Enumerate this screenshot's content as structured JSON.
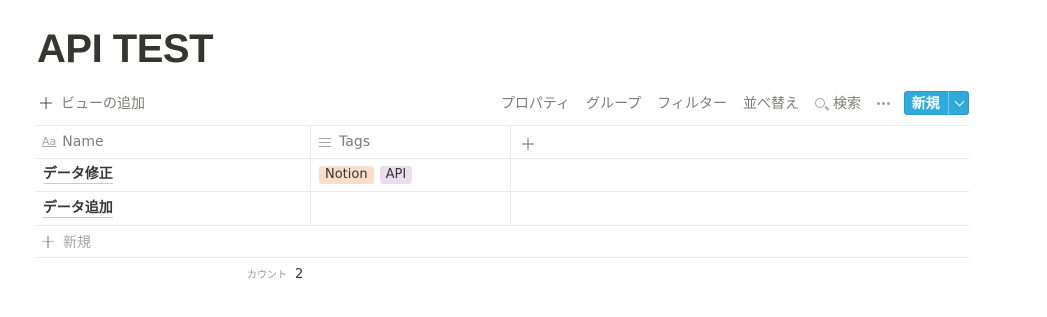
{
  "page": {
    "title": "API TEST"
  },
  "toolbar": {
    "add_view_label": "ビューの追加",
    "properties_label": "プロパティ",
    "group_label": "グループ",
    "filter_label": "フィルター",
    "sort_label": "並べ替え",
    "search_label": "検索",
    "more_icon": "more-horizontal-icon",
    "new_label": "新規",
    "new_color": "#2eaadc"
  },
  "table": {
    "columns": [
      {
        "label": "Name",
        "icon": "text-aa-icon"
      },
      {
        "label": "Tags",
        "icon": "list-icon"
      }
    ],
    "rows": [
      {
        "name": "データ修正",
        "tags": [
          {
            "label": "Notion",
            "color": "#fadec9"
          },
          {
            "label": "API",
            "color": "#e8deee"
          }
        ]
      },
      {
        "name": "データ追加",
        "tags": []
      }
    ],
    "add_row_label": "新規",
    "count_label": "カウント",
    "count_value": "2"
  }
}
